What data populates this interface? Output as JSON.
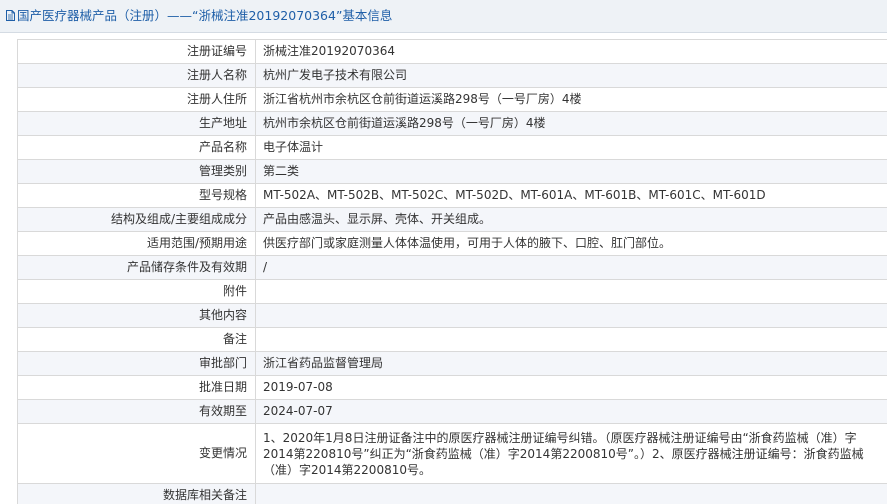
{
  "header": {
    "title": "国产医疗器械产品（注册）——“浙械注准20192070364”基本信息"
  },
  "rows": [
    {
      "label": "注册证编号",
      "value": "浙械注准20192070364"
    },
    {
      "label": "注册人名称",
      "value": "杭州广发电子技术有限公司"
    },
    {
      "label": "注册人住所",
      "value": "浙江省杭州市余杭区仓前街道运溪路298号（一号厂房）4楼"
    },
    {
      "label": "生产地址",
      "value": "杭州市余杭区仓前街道运溪路298号（一号厂房）4楼"
    },
    {
      "label": "产品名称",
      "value": "电子体温计"
    },
    {
      "label": "管理类别",
      "value": "第二类"
    },
    {
      "label": "型号规格",
      "value": "MT-502A、MT-502B、MT-502C、MT-502D、MT-601A、MT-601B、MT-601C、MT-601D"
    },
    {
      "label": "结构及组成/主要组成成分",
      "value": "产品由感温头、显示屏、壳体、开关组成。"
    },
    {
      "label": "适用范围/预期用途",
      "value": "供医疗部门或家庭测量人体体温使用，可用于人体的腋下、口腔、肛门部位。"
    },
    {
      "label": "产品储存条件及有效期",
      "value": "/"
    },
    {
      "label": "附件",
      "value": ""
    },
    {
      "label": "其他内容",
      "value": ""
    },
    {
      "label": "备注",
      "value": ""
    },
    {
      "label": "审批部门",
      "value": "浙江省药品监督管理局"
    },
    {
      "label": "批准日期",
      "value": "2019-07-08"
    },
    {
      "label": "有效期至",
      "value": "2024-07-07"
    },
    {
      "label": "变更情况",
      "value": "1、2020年1月8日注册证备注中的原医疗器械注册证编号纠错。（原医疗器械注册证编号由“浙食药监械（准）字2014第220810号”纠正为“浙食药监械（准）字2014第2200810号”。）2、原医疗器械注册证编号：浙食药监械（准）字2014第2200810号。"
    },
    {
      "label": "数据库相关备注",
      "value": ""
    }
  ],
  "colors": {
    "header_bg": "#eef2f6",
    "header_text": "#1f5fa8",
    "border": "#d9d9d9",
    "alt_row_bg": "#f4f6fa"
  }
}
